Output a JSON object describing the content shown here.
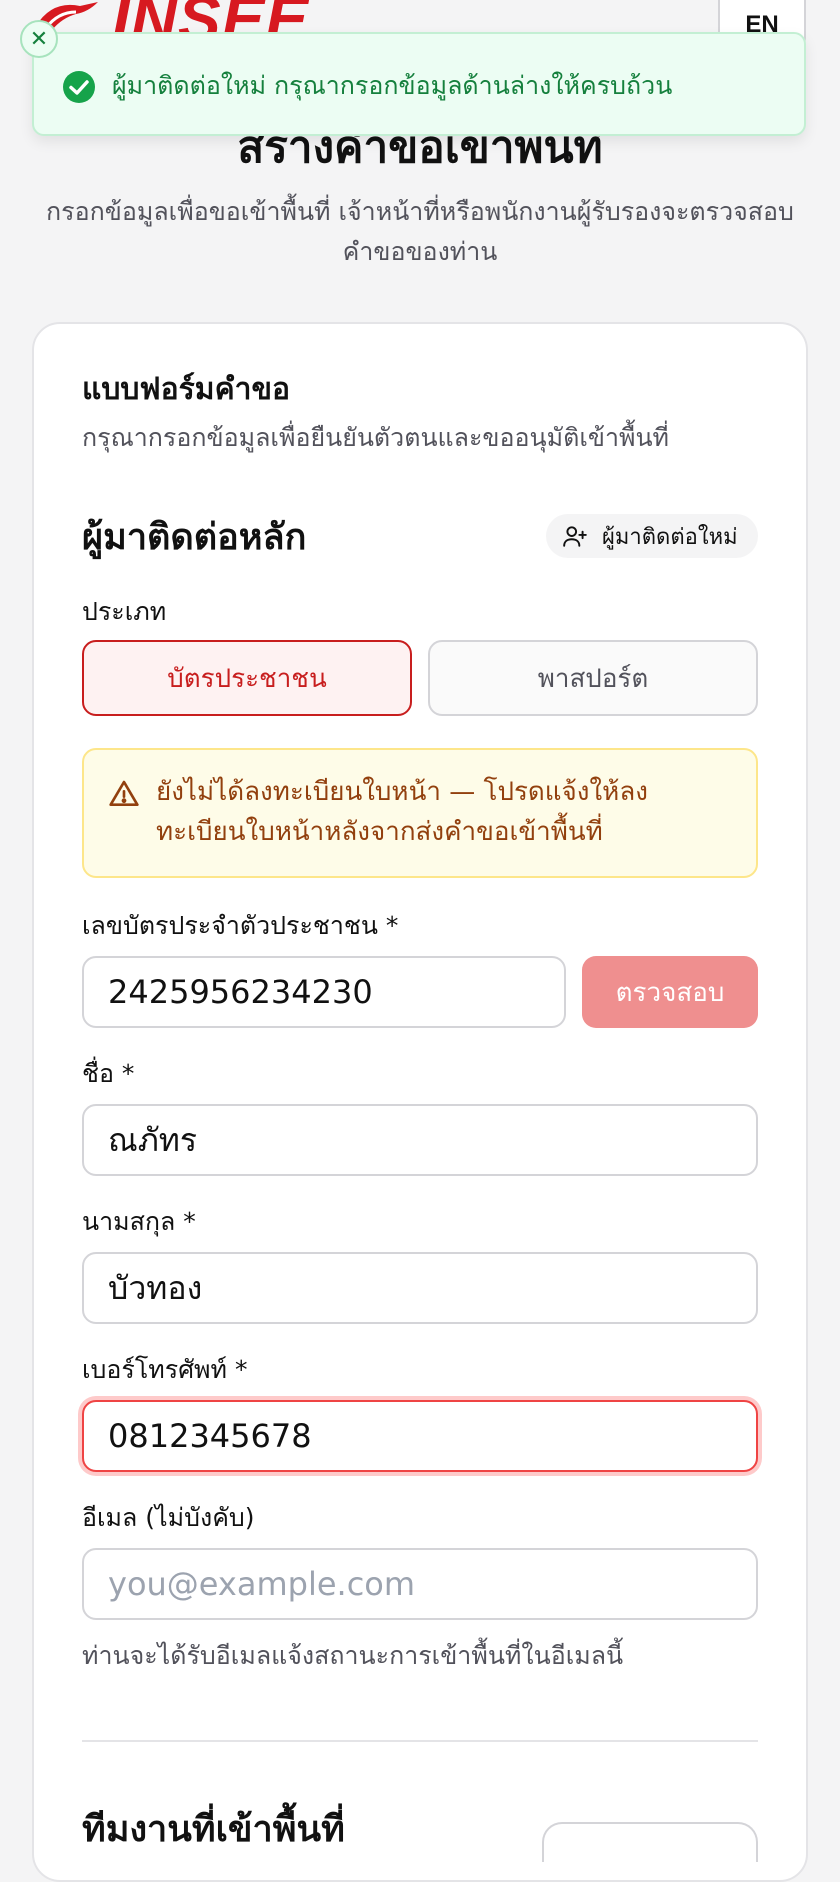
{
  "header": {
    "logo_text": "INSEE",
    "language_button": "EN"
  },
  "page": {
    "title": "สร้างคำขอเข้าพื้นที่",
    "subtitle": "กรอกข้อมูลเพื่อขอเข้าพื้นที่ เจ้าหน้าที่หรือพนักงานผู้รับรองจะตรวจสอบคำขอของท่าน"
  },
  "toast": {
    "message": "ผู้มาติดต่อใหม่ กรุณากรอกข้อมูลด้านล่างให้ครบถ้วน",
    "status_color": "#15803d"
  },
  "form": {
    "title": "แบบฟอร์มคำขอ",
    "subtitle": "กรุณากรอกข้อมูลเพื่อยืนยันตัวตนและขออนุมัติเข้าพื้นที่",
    "primary_contact": {
      "title": "ผู้มาติดต่อหลัก",
      "new_contact_button": "ผู้มาติดต่อใหม่",
      "type_label": "ประเภท",
      "type_options": [
        "บัตรประชาชน",
        "พาสปอร์ต"
      ],
      "type_selected": "บัตรประชาชน",
      "warning": "ยังไม่ได้ลงทะเบียนใบหน้า — โปรดแจ้งให้ลงทะเบียนใบหน้าหลังจากส่งคำขอเข้าพื้นที่",
      "id_label": "เลขบัตรประจำตัวประชาชน *",
      "id_value": "2425956234230",
      "verify_button": "ตรวจสอบ",
      "first_name_label": "ชื่อ *",
      "first_name_value": "ณภัทร",
      "last_name_label": "นามสกุล *",
      "last_name_value": "บัวทอง",
      "phone_label": "เบอร์โทรศัพท์ *",
      "phone_value": "0812345678",
      "email_label": "อีเมล (ไม่บังคับ)",
      "email_placeholder": "you@example.com",
      "email_hint": "ท่านจะได้รับอีเมลแจ้งสถานะการเข้าพื้นที่ในอีเมลนี้"
    },
    "section2_title": "ทีมงานที่เข้าพื้นที่"
  },
  "colors": {
    "brand": "#d71920",
    "selected_border": "#c81e1e",
    "warning_text": "#92400e"
  }
}
